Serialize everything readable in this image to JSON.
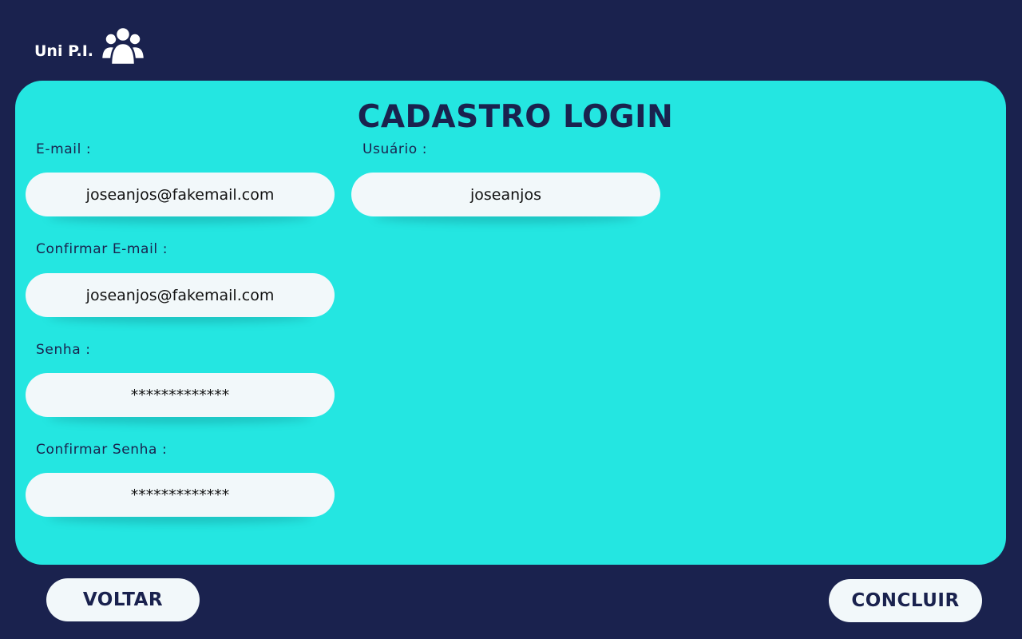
{
  "header": {
    "brand_name": "Uni P.I.",
    "brand_icon": "users-group-icon"
  },
  "form": {
    "title": "CADASTRO LOGIN",
    "fields": {
      "email": {
        "label": "E-mail  :",
        "value": "joseanjos@fakemail.com"
      },
      "usuario": {
        "label": "Usuário  :",
        "value": "joseanjos"
      },
      "confirm_email": {
        "label": "Confirmar E-mail  :",
        "value": "joseanjos@fakemail.com"
      },
      "senha": {
        "label": "Senha  :",
        "value": "*************"
      },
      "confirm_senha": {
        "label": "Confirmar Senha  :",
        "value": "*************"
      }
    }
  },
  "actions": {
    "back_label": "VOLTAR",
    "finish_label": "CONCLUIR"
  },
  "colors": {
    "background": "#1a224e",
    "card": "#24e6e1",
    "field": "#f2f8fa",
    "text_dark": "#1a224e"
  }
}
